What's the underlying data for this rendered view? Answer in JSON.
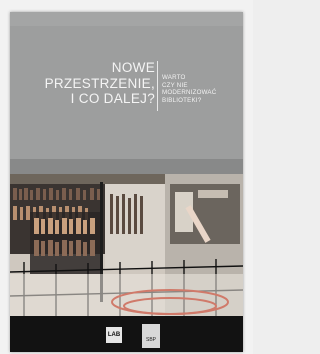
{
  "cover": {
    "title_lines": [
      "NOWE",
      "PRZESTRZENIE,",
      "I CO DALEJ?"
    ],
    "subtitle_lines": [
      "WARTO",
      "CZY NIE",
      "MODERNIZOWAĆ",
      "BIBLIOTEKI?"
    ]
  },
  "logos": {
    "left_text": "LAB",
    "right_text": "SBP"
  }
}
